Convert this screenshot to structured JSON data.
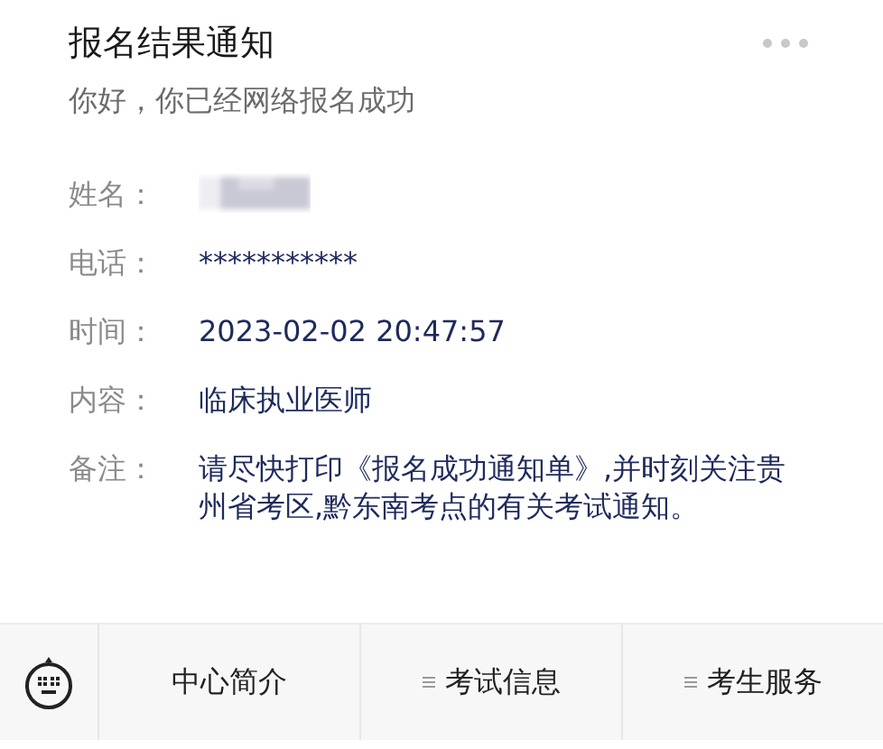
{
  "title": "报名结果通知",
  "subtitle": "你好，你已经网络报名成功",
  "fields": [
    {
      "label": "姓名：",
      "kind": "redacted"
    },
    {
      "label": "电话：",
      "kind": "text",
      "value": "***********"
    },
    {
      "label": "时间：",
      "kind": "text",
      "value": "2023-02-02 20:47:57"
    },
    {
      "label": "内容：",
      "kind": "text",
      "value": "临床执业医师"
    },
    {
      "label": "备注：",
      "kind": "text",
      "value": "请尽快打印《报名成功通知单》,并时刻关注贵州省考区,黔东南考点的有关考试通知。"
    }
  ],
  "menu": [
    {
      "label": "中心简介",
      "has_submenu": false
    },
    {
      "label": "考试信息",
      "has_submenu": true
    },
    {
      "label": "考生服务",
      "has_submenu": true
    }
  ]
}
